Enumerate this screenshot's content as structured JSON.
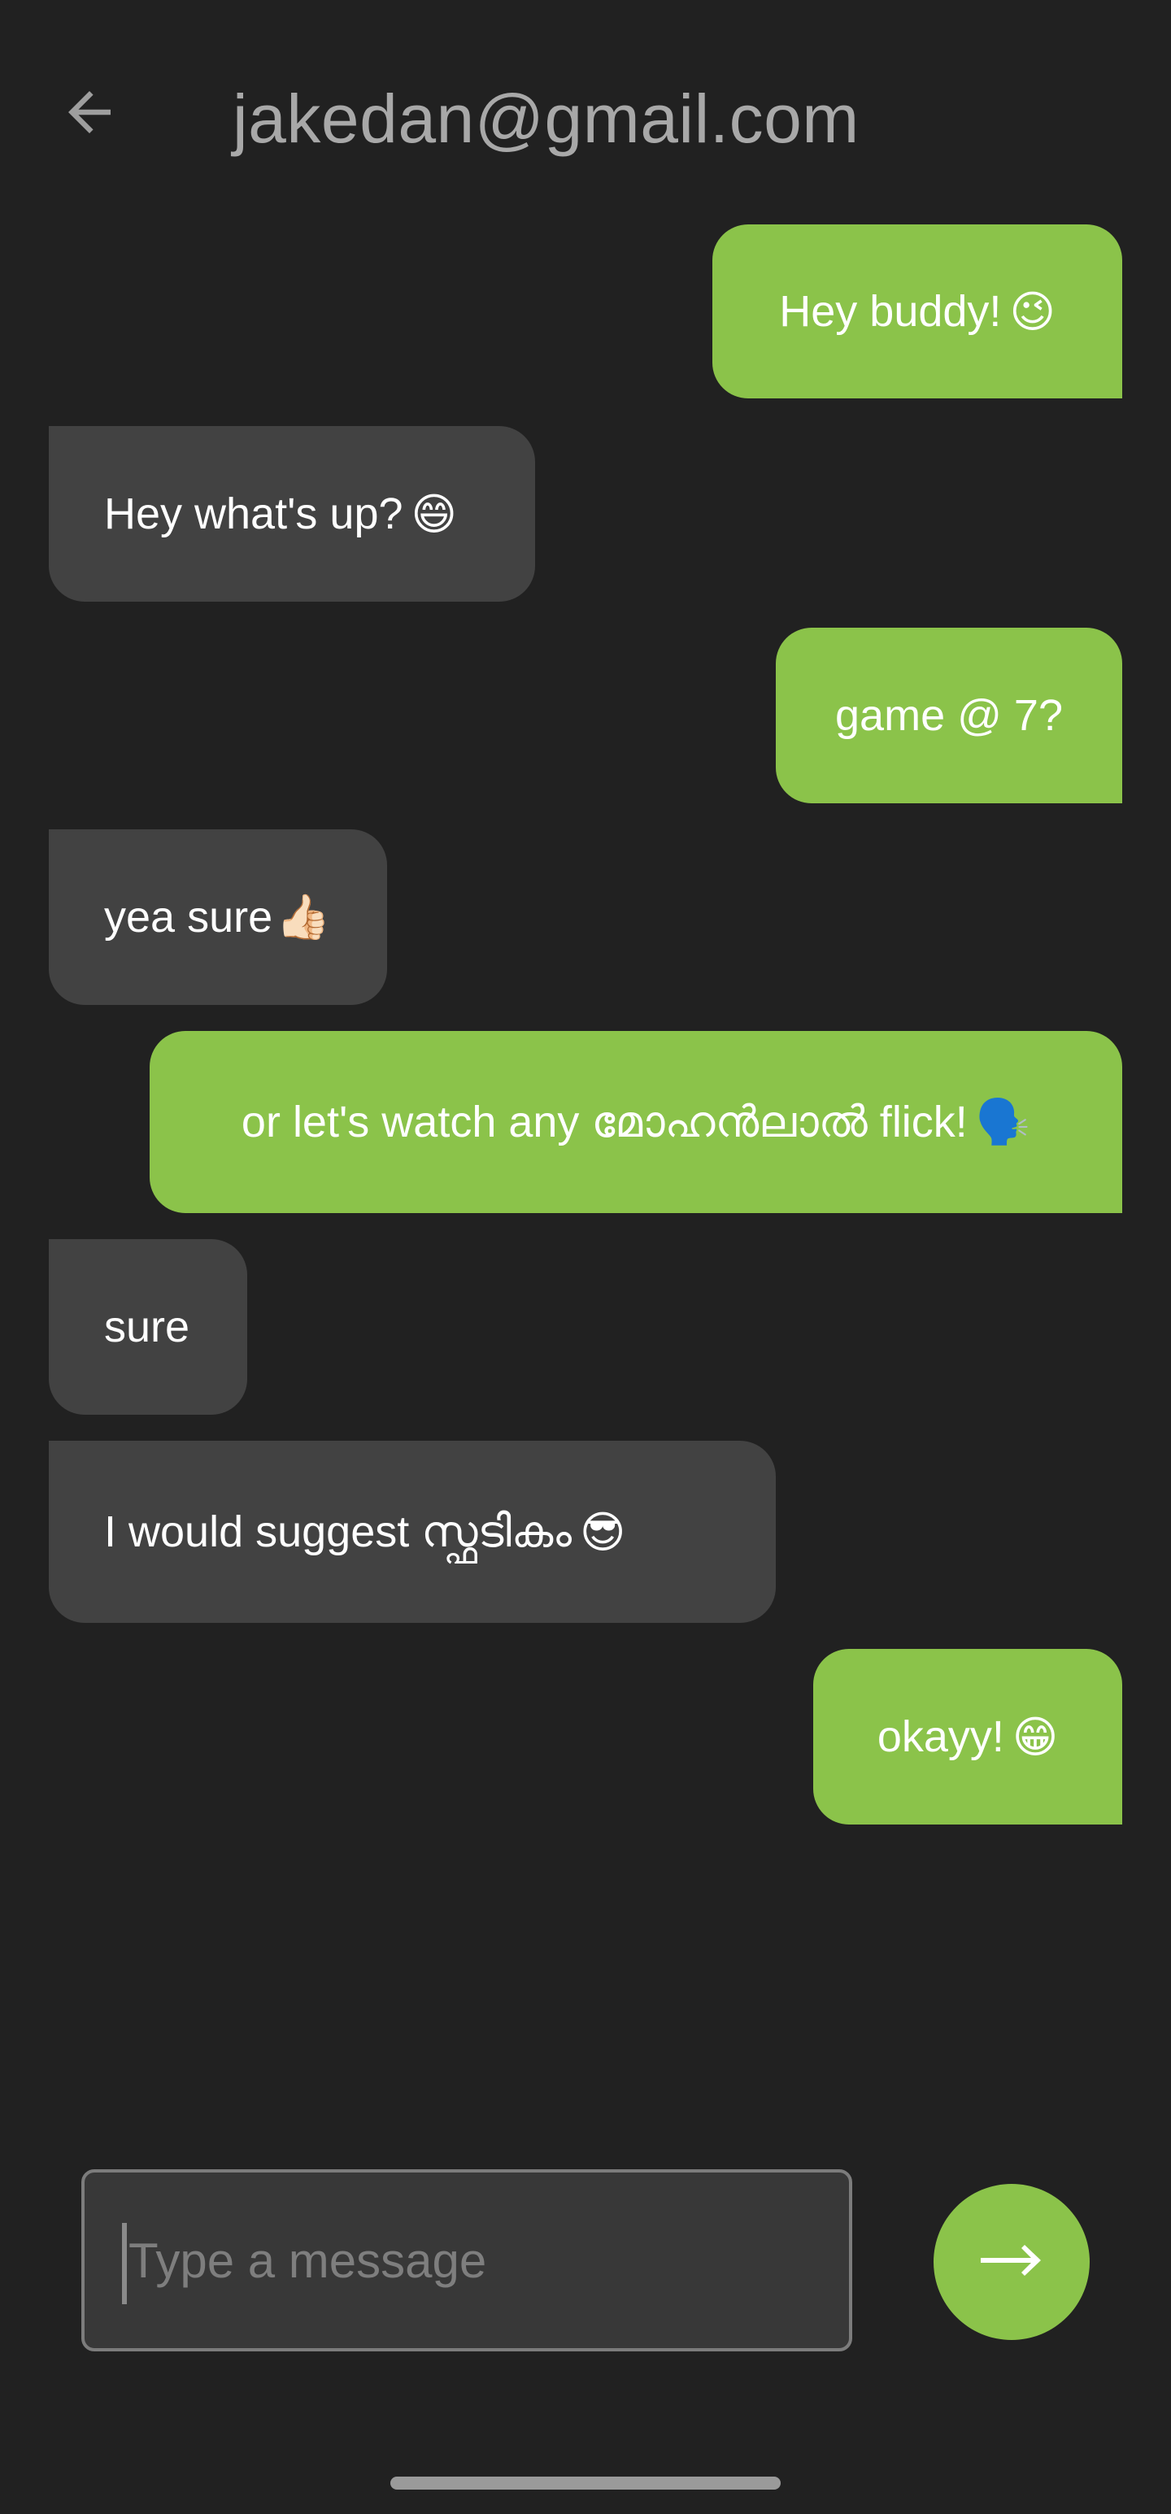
{
  "header": {
    "title": "jakedan@gmail.com",
    "back_icon": "arrow-left-icon"
  },
  "messages": [
    {
      "from": "me",
      "text": "Hey buddy!",
      "emoji": "😉"
    },
    {
      "from": "them",
      "text": "Hey what's up?",
      "emoji": "😄"
    },
    {
      "from": "me",
      "text": "game @ 7?",
      "emoji": ""
    },
    {
      "from": "them",
      "text": "yea sure",
      "emoji": "👍🏻"
    },
    {
      "from": "me",
      "text": "or let's watch any മോഹൻലാൽ flick!",
      "emoji": "🗣️"
    },
    {
      "from": "them",
      "text": "sure",
      "emoji": ""
    },
    {
      "from": "them",
      "text": "I would suggest സ്ഫടികം",
      "emoji": "😎"
    },
    {
      "from": "me",
      "text": "okayy!",
      "emoji": "😁"
    }
  ],
  "composer": {
    "placeholder": "Type a message",
    "value": ""
  },
  "send_icon": "arrow-right-icon",
  "colors": {
    "background": "#212121",
    "sent_bubble": "#8bc34a",
    "received_bubble": "#424242",
    "text": "#ffffff",
    "title": "#a8a8a8"
  }
}
